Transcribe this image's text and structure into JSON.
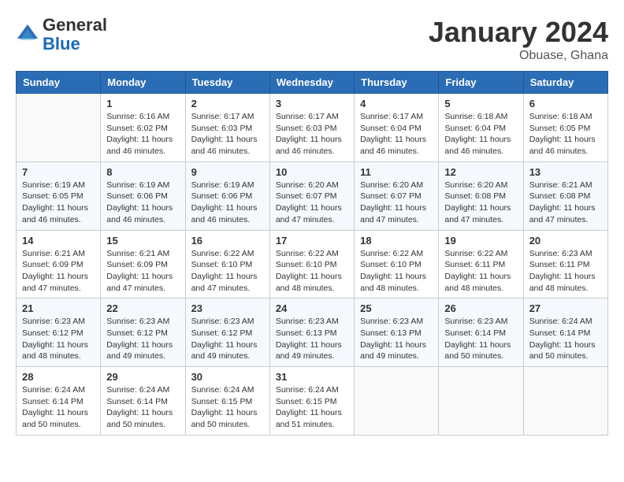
{
  "logo": {
    "general": "General",
    "blue": "Blue"
  },
  "title": "January 2024",
  "location": "Obuase, Ghana",
  "days_of_week": [
    "Sunday",
    "Monday",
    "Tuesday",
    "Wednesday",
    "Thursday",
    "Friday",
    "Saturday"
  ],
  "weeks": [
    [
      {
        "day": "",
        "sunrise": "",
        "sunset": "",
        "daylight": ""
      },
      {
        "day": "1",
        "sunrise": "Sunrise: 6:16 AM",
        "sunset": "Sunset: 6:02 PM",
        "daylight": "Daylight: 11 hours and 46 minutes."
      },
      {
        "day": "2",
        "sunrise": "Sunrise: 6:17 AM",
        "sunset": "Sunset: 6:03 PM",
        "daylight": "Daylight: 11 hours and 46 minutes."
      },
      {
        "day": "3",
        "sunrise": "Sunrise: 6:17 AM",
        "sunset": "Sunset: 6:03 PM",
        "daylight": "Daylight: 11 hours and 46 minutes."
      },
      {
        "day": "4",
        "sunrise": "Sunrise: 6:17 AM",
        "sunset": "Sunset: 6:04 PM",
        "daylight": "Daylight: 11 hours and 46 minutes."
      },
      {
        "day": "5",
        "sunrise": "Sunrise: 6:18 AM",
        "sunset": "Sunset: 6:04 PM",
        "daylight": "Daylight: 11 hours and 46 minutes."
      },
      {
        "day": "6",
        "sunrise": "Sunrise: 6:18 AM",
        "sunset": "Sunset: 6:05 PM",
        "daylight": "Daylight: 11 hours and 46 minutes."
      }
    ],
    [
      {
        "day": "7",
        "sunrise": "Sunrise: 6:19 AM",
        "sunset": "Sunset: 6:05 PM",
        "daylight": "Daylight: 11 hours and 46 minutes."
      },
      {
        "day": "8",
        "sunrise": "Sunrise: 6:19 AM",
        "sunset": "Sunset: 6:06 PM",
        "daylight": "Daylight: 11 hours and 46 minutes."
      },
      {
        "day": "9",
        "sunrise": "Sunrise: 6:19 AM",
        "sunset": "Sunset: 6:06 PM",
        "daylight": "Daylight: 11 hours and 46 minutes."
      },
      {
        "day": "10",
        "sunrise": "Sunrise: 6:20 AM",
        "sunset": "Sunset: 6:07 PM",
        "daylight": "Daylight: 11 hours and 47 minutes."
      },
      {
        "day": "11",
        "sunrise": "Sunrise: 6:20 AM",
        "sunset": "Sunset: 6:07 PM",
        "daylight": "Daylight: 11 hours and 47 minutes."
      },
      {
        "day": "12",
        "sunrise": "Sunrise: 6:20 AM",
        "sunset": "Sunset: 6:08 PM",
        "daylight": "Daylight: 11 hours and 47 minutes."
      },
      {
        "day": "13",
        "sunrise": "Sunrise: 6:21 AM",
        "sunset": "Sunset: 6:08 PM",
        "daylight": "Daylight: 11 hours and 47 minutes."
      }
    ],
    [
      {
        "day": "14",
        "sunrise": "Sunrise: 6:21 AM",
        "sunset": "Sunset: 6:09 PM",
        "daylight": "Daylight: 11 hours and 47 minutes."
      },
      {
        "day": "15",
        "sunrise": "Sunrise: 6:21 AM",
        "sunset": "Sunset: 6:09 PM",
        "daylight": "Daylight: 11 hours and 47 minutes."
      },
      {
        "day": "16",
        "sunrise": "Sunrise: 6:22 AM",
        "sunset": "Sunset: 6:10 PM",
        "daylight": "Daylight: 11 hours and 47 minutes."
      },
      {
        "day": "17",
        "sunrise": "Sunrise: 6:22 AM",
        "sunset": "Sunset: 6:10 PM",
        "daylight": "Daylight: 11 hours and 48 minutes."
      },
      {
        "day": "18",
        "sunrise": "Sunrise: 6:22 AM",
        "sunset": "Sunset: 6:10 PM",
        "daylight": "Daylight: 11 hours and 48 minutes."
      },
      {
        "day": "19",
        "sunrise": "Sunrise: 6:22 AM",
        "sunset": "Sunset: 6:11 PM",
        "daylight": "Daylight: 11 hours and 48 minutes."
      },
      {
        "day": "20",
        "sunrise": "Sunrise: 6:23 AM",
        "sunset": "Sunset: 6:11 PM",
        "daylight": "Daylight: 11 hours and 48 minutes."
      }
    ],
    [
      {
        "day": "21",
        "sunrise": "Sunrise: 6:23 AM",
        "sunset": "Sunset: 6:12 PM",
        "daylight": "Daylight: 11 hours and 48 minutes."
      },
      {
        "day": "22",
        "sunrise": "Sunrise: 6:23 AM",
        "sunset": "Sunset: 6:12 PM",
        "daylight": "Daylight: 11 hours and 49 minutes."
      },
      {
        "day": "23",
        "sunrise": "Sunrise: 6:23 AM",
        "sunset": "Sunset: 6:12 PM",
        "daylight": "Daylight: 11 hours and 49 minutes."
      },
      {
        "day": "24",
        "sunrise": "Sunrise: 6:23 AM",
        "sunset": "Sunset: 6:13 PM",
        "daylight": "Daylight: 11 hours and 49 minutes."
      },
      {
        "day": "25",
        "sunrise": "Sunrise: 6:23 AM",
        "sunset": "Sunset: 6:13 PM",
        "daylight": "Daylight: 11 hours and 49 minutes."
      },
      {
        "day": "26",
        "sunrise": "Sunrise: 6:23 AM",
        "sunset": "Sunset: 6:14 PM",
        "daylight": "Daylight: 11 hours and 50 minutes."
      },
      {
        "day": "27",
        "sunrise": "Sunrise: 6:24 AM",
        "sunset": "Sunset: 6:14 PM",
        "daylight": "Daylight: 11 hours and 50 minutes."
      }
    ],
    [
      {
        "day": "28",
        "sunrise": "Sunrise: 6:24 AM",
        "sunset": "Sunset: 6:14 PM",
        "daylight": "Daylight: 11 hours and 50 minutes."
      },
      {
        "day": "29",
        "sunrise": "Sunrise: 6:24 AM",
        "sunset": "Sunset: 6:14 PM",
        "daylight": "Daylight: 11 hours and 50 minutes."
      },
      {
        "day": "30",
        "sunrise": "Sunrise: 6:24 AM",
        "sunset": "Sunset: 6:15 PM",
        "daylight": "Daylight: 11 hours and 50 minutes."
      },
      {
        "day": "31",
        "sunrise": "Sunrise: 6:24 AM",
        "sunset": "Sunset: 6:15 PM",
        "daylight": "Daylight: 11 hours and 51 minutes."
      },
      {
        "day": "",
        "sunrise": "",
        "sunset": "",
        "daylight": ""
      },
      {
        "day": "",
        "sunrise": "",
        "sunset": "",
        "daylight": ""
      },
      {
        "day": "",
        "sunrise": "",
        "sunset": "",
        "daylight": ""
      }
    ]
  ]
}
